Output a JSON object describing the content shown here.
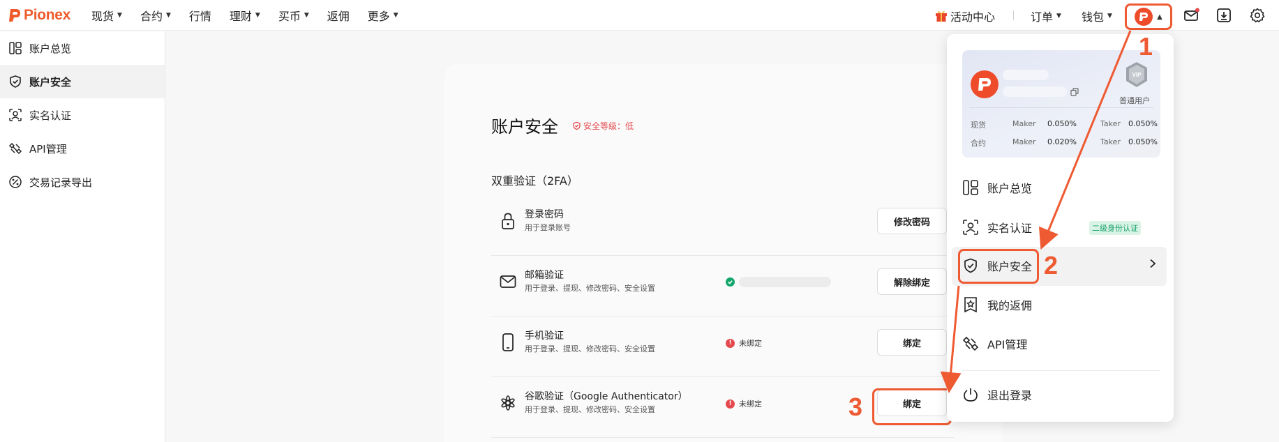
{
  "brand": {
    "name": "Pionex",
    "accent": "#ef5a2b"
  },
  "topnav": {
    "items": [
      {
        "label": "现货",
        "caret": true
      },
      {
        "label": "合约",
        "caret": true
      },
      {
        "label": "行情",
        "caret": false
      },
      {
        "label": "理财",
        "caret": true
      },
      {
        "label": "买币",
        "caret": true
      },
      {
        "label": "返佣",
        "caret": false
      },
      {
        "label": "更多",
        "caret": true
      }
    ],
    "activity": "活动中心",
    "orders": "订单",
    "wallet": "钱包"
  },
  "sidebar": {
    "items": [
      {
        "label": "账户总览",
        "icon": "overview-icon"
      },
      {
        "label": "账户安全",
        "icon": "shield-icon",
        "active": true
      },
      {
        "label": "实名认证",
        "icon": "id-verify-icon"
      },
      {
        "label": "API管理",
        "icon": "api-icon"
      },
      {
        "label": "交易记录导出",
        "icon": "export-icon"
      }
    ]
  },
  "main": {
    "title": "账户安全",
    "security_level": "安全等级：低",
    "section_title": "双重验证（2FA）",
    "rows": [
      {
        "title": "登录密码",
        "subtitle": "用于登录账号",
        "button": "修改密码",
        "icon": "lock-icon"
      },
      {
        "title": "邮箱验证",
        "subtitle": "用于登录、提现、修改密码、安全设置",
        "button": "解除绑定",
        "status": "bound",
        "icon": "mail-icon"
      },
      {
        "title": "手机验证",
        "subtitle": "用于登录、提现、修改密码、安全设置",
        "button": "绑定",
        "status_text": "未绑定",
        "icon": "phone-icon"
      },
      {
        "title": "谷歌验证（Google Authenticator）",
        "subtitle": "用于登录、提现、修改密码、安全设置",
        "button": "绑定",
        "status_text": "未绑定",
        "icon": "google-auth-icon"
      }
    ]
  },
  "dropdown": {
    "user_level": "普通用户",
    "vip": "VIP",
    "fees": [
      {
        "market": "现货",
        "maker_label": "Maker",
        "maker": "0.050%",
        "taker_label": "Taker",
        "taker": "0.050%"
      },
      {
        "market": "合约",
        "maker_label": "Maker",
        "maker": "0.020%",
        "taker_label": "Taker",
        "taker": "0.050%"
      }
    ],
    "menu": [
      {
        "label": "账户总览",
        "icon": "overview-icon"
      },
      {
        "label": "实名认证",
        "icon": "id-verify-icon",
        "badge": "二级身份认证"
      },
      {
        "label": "账户安全",
        "icon": "shield-icon",
        "active": true
      },
      {
        "label": "我的返佣",
        "icon": "rebate-icon"
      },
      {
        "label": "API管理",
        "icon": "api-icon"
      },
      {
        "label": "退出登录",
        "icon": "power-icon"
      }
    ]
  },
  "annotations": {
    "step1": "1",
    "step2": "2",
    "step3": "3",
    "color": "#ee5a32"
  }
}
